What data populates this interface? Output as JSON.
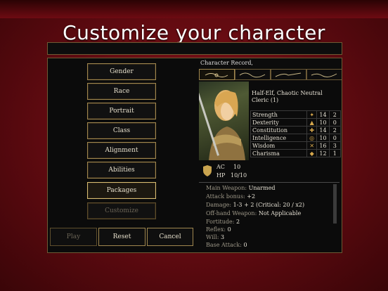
{
  "title": "Customize your character",
  "menu": [
    {
      "label": "Gender",
      "state": "normal"
    },
    {
      "label": "Race",
      "state": "normal"
    },
    {
      "label": "Portrait",
      "state": "normal"
    },
    {
      "label": "Class",
      "state": "normal"
    },
    {
      "label": "Alignment",
      "state": "normal"
    },
    {
      "label": "Abilities",
      "state": "normal"
    },
    {
      "label": "Packages",
      "state": "selected"
    },
    {
      "label": "Customize",
      "state": "disabled"
    }
  ],
  "bottom_buttons": {
    "play": "Play",
    "reset": "Reset",
    "cancel": "Cancel"
  },
  "record": {
    "header": "Character Record,",
    "line1": "Half-Elf, Chaotic Neutral",
    "line2": "Cleric (1)",
    "stats": [
      {
        "name": "Strength",
        "icon": "strength-icon",
        "score": "14",
        "mod": "2"
      },
      {
        "name": "Dexterity",
        "icon": "dexterity-icon",
        "score": "10",
        "mod": "0"
      },
      {
        "name": "Constitution",
        "icon": "constitution-icon",
        "score": "14",
        "mod": "2"
      },
      {
        "name": "Intelligence",
        "icon": "intelligence-icon",
        "score": "10",
        "mod": "0"
      },
      {
        "name": "Wisdom",
        "icon": "wisdom-icon",
        "score": "16",
        "mod": "3"
      },
      {
        "name": "Charisma",
        "icon": "charisma-icon",
        "score": "12",
        "mod": "1"
      }
    ],
    "ac_label": "AC",
    "ac_value": "10",
    "hp_label": "HP",
    "hp_value": "10/10",
    "details": [
      {
        "label": "Main Weapon: ",
        "value": "Unarmed"
      },
      {
        "label": "Attack bonus: ",
        "value": "+2"
      },
      {
        "label": "Damage: ",
        "value": "1-3 + 2 (Critical: 20 / x2)"
      },
      {
        "label": "Off-hand Weapon: ",
        "value": "Not Applicable"
      },
      {
        "label": "Fortitude: ",
        "value": "2"
      },
      {
        "label": "Reflex: ",
        "value": "0"
      },
      {
        "label": "Will: ",
        "value": "3"
      },
      {
        "label": "Base Attack: ",
        "value": "0"
      }
    ]
  },
  "colors": {
    "accent": "#a0874f",
    "background": "#6e0b12"
  }
}
